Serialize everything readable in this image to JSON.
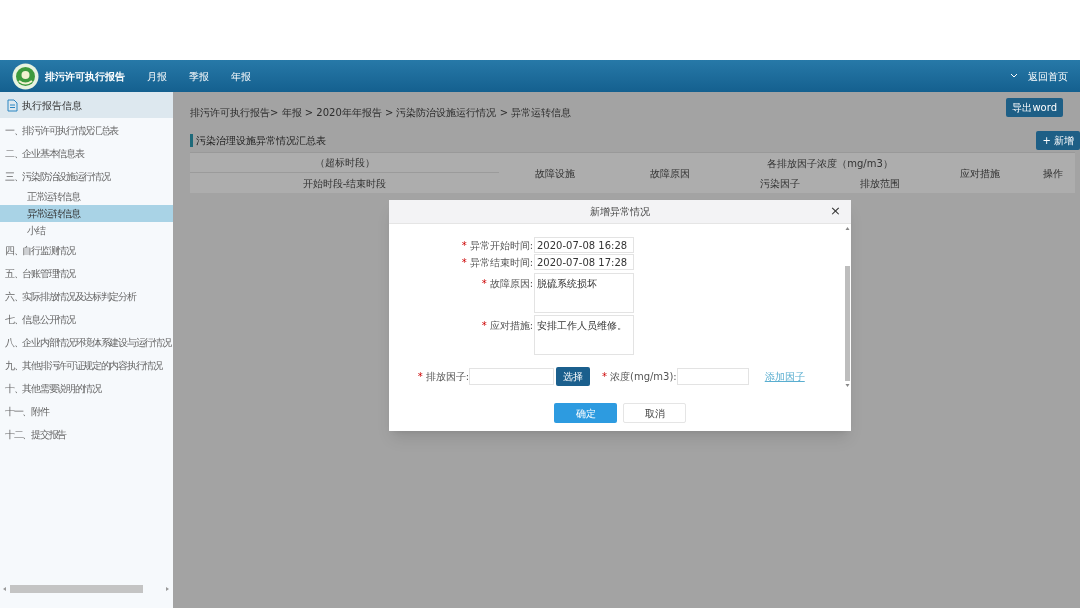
{
  "header": {
    "title": "排污许可执行报告",
    "tabs": [
      "月报",
      "季报",
      "年报"
    ],
    "home_link": "返回首页"
  },
  "sidebar": {
    "title": "执行报告信息",
    "items": [
      {
        "label": "一、排污许可执行情况汇总表",
        "selected": false
      },
      {
        "label": "二、企业基本信息表",
        "selected": false
      },
      {
        "label": "三、污染防治设施运行情况",
        "selected": false,
        "children": [
          {
            "label": "正常运转信息",
            "selected": false
          },
          {
            "label": "异常运转信息",
            "selected": true
          },
          {
            "label": "小结",
            "selected": false
          }
        ]
      },
      {
        "label": "四、自行监测情况",
        "selected": false
      },
      {
        "label": "五、台账管理情况",
        "selected": false
      },
      {
        "label": "六、实际排放情况及达标判定分析",
        "selected": false
      },
      {
        "label": "七、信息公开情况",
        "selected": false
      },
      {
        "label": "八、企业内部情况环境体系建设与运行情况",
        "selected": false
      },
      {
        "label": "九、其他排污许可证规定的内容执行情况",
        "selected": false
      },
      {
        "label": "十、其他需要说明的情况",
        "selected": false
      },
      {
        "label": "十一、附件",
        "selected": false
      },
      {
        "label": "十二、提交报告",
        "selected": false
      }
    ]
  },
  "breadcrumb": "排污许可执行报告> 年报 > 2020年年报告 > 污染防治设施运行情况 > 异常运转信息",
  "export_button": "导出word",
  "section_title": "污染治理设施异常情况汇总表",
  "add_button": "+ 新增",
  "table": {
    "group_1": "（超标时段）",
    "group_1_sub": "开始时段-结束时段",
    "col_facility": "故障设施",
    "col_reason": "故障原因",
    "group_2": "各排放因子浓度（mg/m3）",
    "group_2_subs": [
      "污染因子",
      "排放范围"
    ],
    "col_measures": "应对措施",
    "col_action": "操作"
  },
  "dialog": {
    "title": "新增异常情况",
    "close": "×",
    "fields": [
      {
        "kind": "input",
        "mark": "*",
        "label": "异常开始时间:",
        "value": "2020-07-08 16:28"
      },
      {
        "kind": "input",
        "mark": "*",
        "label": "异常结束时间:",
        "value": "2020-07-08 17:28"
      },
      {
        "kind": "textarea",
        "mark": "*",
        "label": "故障原因:",
        "value": "脱硫系统损坏"
      },
      {
        "kind": "textarea",
        "mark": "*",
        "label": "应对措施:",
        "value": "安排工作人员维修。"
      }
    ],
    "factor_mark": "*",
    "concentration_mark": "*",
    "factor_label": "排放因子:",
    "select_button": "选择",
    "concentration_label": "浓度(mg/m3):",
    "add_factor_link": "添加因子",
    "ok_button": "确定",
    "cancel_button": "取消"
  }
}
